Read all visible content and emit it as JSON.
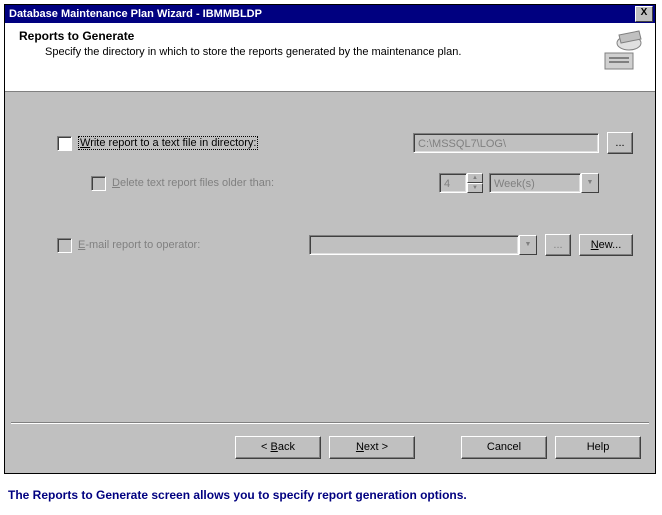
{
  "titlebar": {
    "title": "Database Maintenance Plan Wizard - IBMMBLDP",
    "close_x": "X"
  },
  "header": {
    "title": "Reports to Generate",
    "subtitle": "Specify the directory in which to store the reports generated by the maintenance plan."
  },
  "form": {
    "write_report": {
      "label_pre": "W",
      "label_rest": "rite report to a text file in directory:",
      "path": "C:\\MSSQL7\\LOG\\",
      "browse": "..."
    },
    "delete_old": {
      "label_pre": "D",
      "label_rest": "elete text report files older than:",
      "value": "4",
      "unit": "Week(s)"
    },
    "email": {
      "label_pre": "E",
      "label_rest": "-mail report to operator:",
      "operator": "",
      "browse": "...",
      "new_label": "New..."
    }
  },
  "buttons": {
    "back": "< Back",
    "next": "Next >",
    "cancel": "Cancel",
    "help": "Help"
  },
  "caption": "The Reports to Generate screen allows you to specify report generation options."
}
